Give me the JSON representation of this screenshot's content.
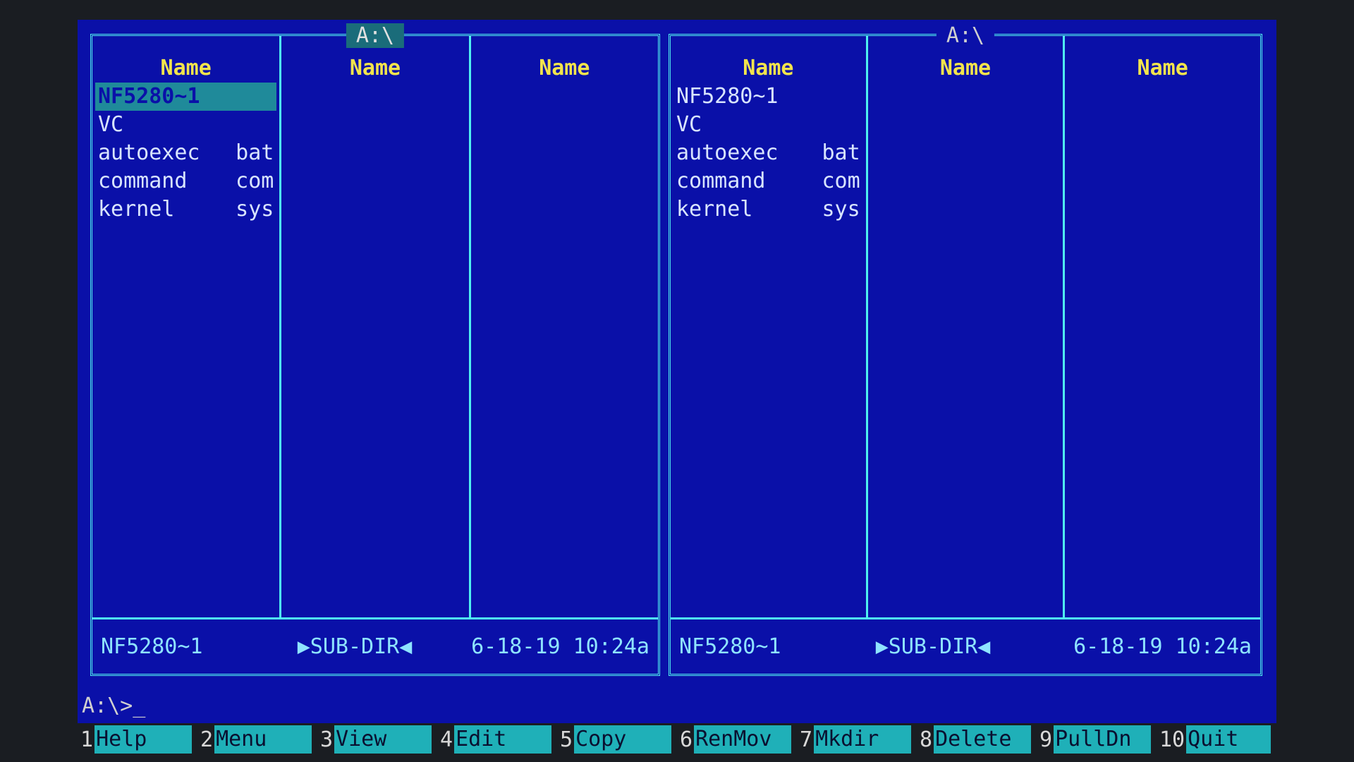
{
  "left_panel": {
    "title": "A:\\",
    "columns": [
      {
        "header": "Name",
        "files": [
          {
            "name": "NF5280~1",
            "ext": "",
            "selected": true
          },
          {
            "name": "VC",
            "ext": ""
          },
          {
            "name": "autoexec",
            "ext": "bat"
          },
          {
            "name": "command",
            "ext": "com"
          },
          {
            "name": "kernel",
            "ext": "sys"
          }
        ]
      },
      {
        "header": "Name",
        "files": []
      },
      {
        "header": "Name",
        "files": []
      }
    ],
    "status": {
      "name": "NF5280~1",
      "type": "▶SUB-DIR◀",
      "datetime": "6-18-19 10:24a"
    }
  },
  "right_panel": {
    "title": "A:\\",
    "columns": [
      {
        "header": "Name",
        "files": [
          {
            "name": "NF5280~1",
            "ext": ""
          },
          {
            "name": "VC",
            "ext": ""
          },
          {
            "name": "autoexec",
            "ext": "bat"
          },
          {
            "name": "command",
            "ext": "com"
          },
          {
            "name": "kernel",
            "ext": "sys"
          }
        ]
      },
      {
        "header": "Name",
        "files": []
      },
      {
        "header": "Name",
        "files": []
      }
    ],
    "status": {
      "name": "NF5280~1",
      "type": "▶SUB-DIR◀",
      "datetime": "6-18-19 10:24a"
    }
  },
  "prompt": "A:\\>_",
  "function_keys": [
    {
      "num": "1",
      "label": "Help"
    },
    {
      "num": "2",
      "label": "Menu"
    },
    {
      "num": "3",
      "label": "View"
    },
    {
      "num": "4",
      "label": "Edit"
    },
    {
      "num": "5",
      "label": "Copy"
    },
    {
      "num": "6",
      "label": "RenMov"
    },
    {
      "num": "7",
      "label": "Mkdir"
    },
    {
      "num": "8",
      "label": "Delete"
    },
    {
      "num": "9",
      "label": "PullDn"
    },
    {
      "num": "10",
      "label": "Quit"
    }
  ],
  "colors": {
    "background": "#0a10a8",
    "border": "#4ff0f0",
    "header": "#f2e44c",
    "highlight": "#1f8a9a"
  }
}
